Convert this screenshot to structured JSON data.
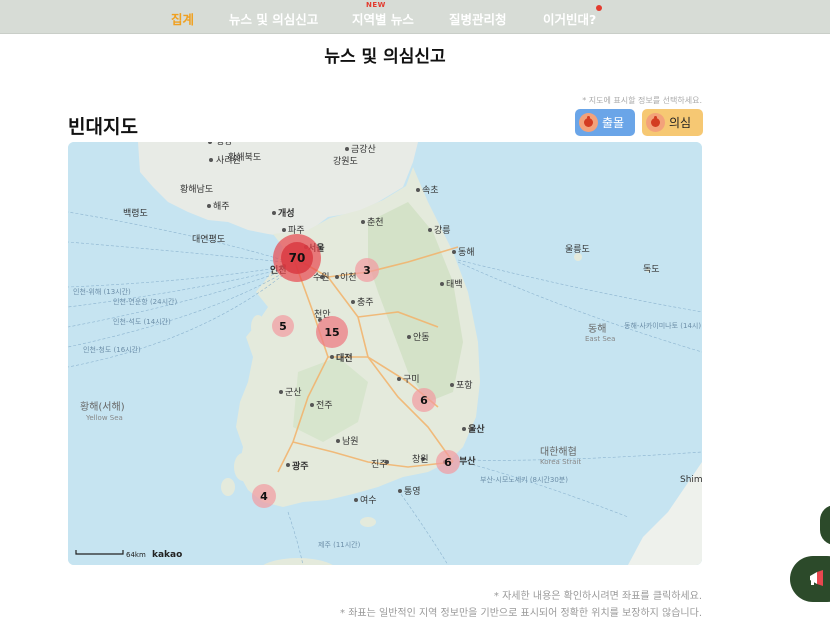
{
  "nav": {
    "items": [
      {
        "label": "집계",
        "active": true
      },
      {
        "label": "뉴스 및 의심신고",
        "active": false
      },
      {
        "label": "지역별 뉴스",
        "active": false,
        "badge": "NEW"
      },
      {
        "label": "질병관리청",
        "active": false
      },
      {
        "label": "이거빈대?",
        "active": false,
        "dot": true
      }
    ]
  },
  "page": {
    "title": "뉴스 및 의심신고",
    "section_title": "빈대지도",
    "map_hint": "* 지도에 표시할 정보를 선택하세요."
  },
  "toggles": {
    "outbreak": "출몰",
    "suspect": "의심"
  },
  "map": {
    "clusters": [
      "70",
      "3",
      "5",
      "15",
      "6",
      "6",
      "4"
    ],
    "cities": [
      "평양",
      "사리원",
      "개성",
      "파주",
      "서울",
      "인천",
      "수원",
      "이천",
      "춘천",
      "강릉",
      "동해",
      "충주",
      "천안",
      "대전",
      "안동",
      "구미",
      "포항",
      "군산",
      "전주",
      "남원",
      "광주",
      "진주",
      "창원",
      "부산",
      "울산",
      "여수",
      "통영",
      "속초",
      "태백",
      "해주",
      "금강산"
    ],
    "regions": [
      "황해북도",
      "황해남도",
      "강원도",
      "백령도",
      "대연평도",
      "울릉도",
      "독도",
      "Shim"
    ],
    "seas": {
      "west": "황해(서해)",
      "west_en": "Yellow Sea",
      "east": "동해",
      "east_en": "East Sea",
      "strait": "대한해협",
      "strait_en": "Korea Strait"
    },
    "routes": [
      "인천-위해 (13시간)",
      "인천-연운항 (24시간)",
      "인천-석도 (14시간)",
      "인천-청도 (16시간)",
      "부산-시모노세키 (8시간30분)",
      "동해-사카이미나토 (14시)",
      "제주 (11시간)"
    ],
    "scale": "64km",
    "logo": "kakao"
  },
  "footnotes": [
    "* 자세한 내용은 확인하시려면 좌표를 클릭하세요.",
    "* 좌표는 일반적인 지역 정보만을 기반으로 표시되어 정확한 위치를 보장하지 않습니다."
  ],
  "colors": {
    "nav_bg": "#d7dcd6",
    "nav_active": "#f0a020",
    "outbreak_btn": "#6aa5e8",
    "suspect_btn": "#f6c873",
    "cluster": "#e8474f",
    "fab": "#2c4a2a"
  },
  "icons": [
    "bug-icon",
    "megaphone-icon"
  ]
}
